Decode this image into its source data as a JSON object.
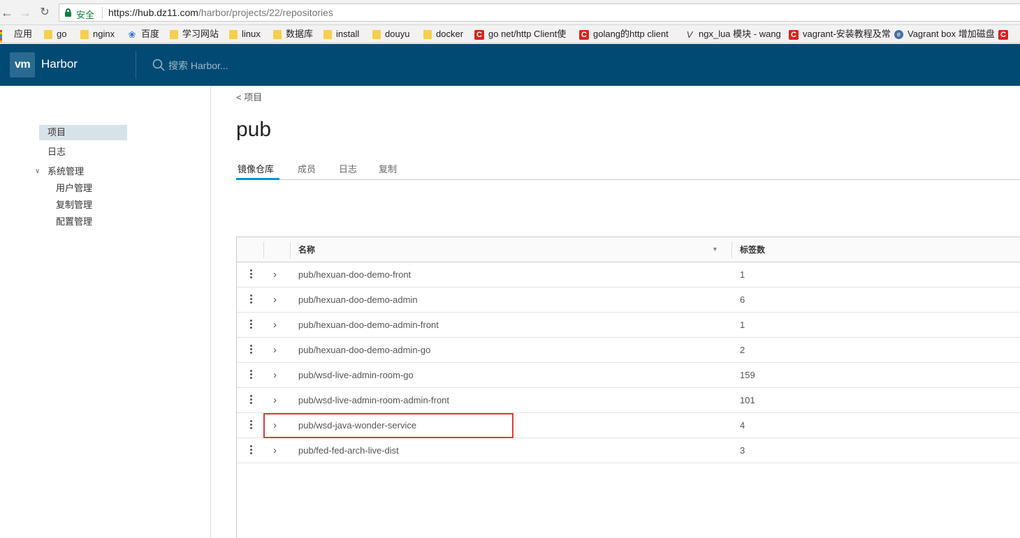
{
  "browser": {
    "secure_label": "安全",
    "url": "https://hub.dz11.com/harbor/projects/22/repositories",
    "url_host_part": "https://hub.dz11.com",
    "url_path_part": "/harbor/projects/22/repositories",
    "bookmarks": [
      {
        "label": "应用",
        "icon": "apps-icon"
      },
      {
        "label": "go",
        "icon": "folder-icon"
      },
      {
        "label": "nginx",
        "icon": "folder-icon"
      },
      {
        "label": "百度",
        "icon": "paw-icon"
      },
      {
        "label": "学习网站",
        "icon": "folder-icon"
      },
      {
        "label": "linux",
        "icon": "folder-icon"
      },
      {
        "label": "数据库",
        "icon": "folder-icon"
      },
      {
        "label": "install",
        "icon": "folder-icon"
      },
      {
        "label": "douyu",
        "icon": "folder-icon"
      },
      {
        "label": "docker",
        "icon": "folder-icon"
      },
      {
        "label": "go net/http Client使",
        "icon": "csdn-icon"
      },
      {
        "label": "golang的http client",
        "icon": "csdn-icon"
      },
      {
        "label": "ngx_lua 模块 - wang",
        "icon": "v-icon"
      },
      {
        "label": "vagrant-安装教程及常",
        "icon": "csdn-icon"
      },
      {
        "label": "Vagrant box 增加磁盘",
        "icon": "globe-icon"
      },
      {
        "label": "",
        "icon": "csdn-icon"
      }
    ]
  },
  "header": {
    "logo_text": "vm",
    "brand": "Harbor",
    "search_placeholder": "搜索 Harbor..."
  },
  "sidebar": {
    "items": [
      {
        "label": "项目",
        "active": true
      },
      {
        "label": "日志",
        "active": false
      },
      {
        "label": "系统管理",
        "active": false,
        "expanded": true
      }
    ],
    "subitems": [
      {
        "label": "用户管理"
      },
      {
        "label": "复制管理"
      },
      {
        "label": "配置管理"
      }
    ]
  },
  "main": {
    "breadcrumb": "< 项目",
    "title": "pub",
    "tabs": [
      {
        "label": "镜像仓库",
        "active": true
      },
      {
        "label": "成员",
        "active": false
      },
      {
        "label": "日志",
        "active": false
      },
      {
        "label": "复制",
        "active": false
      }
    ],
    "table": {
      "columns": [
        "名称",
        "标签数"
      ],
      "rows": [
        {
          "name": "pub/hexuan-doo-demo-front",
          "tags": "1"
        },
        {
          "name": "pub/hexuan-doo-demo-admin",
          "tags": "6"
        },
        {
          "name": "pub/hexuan-doo-demo-admin-front",
          "tags": "1"
        },
        {
          "name": "pub/hexuan-doo-demo-admin-go",
          "tags": "2"
        },
        {
          "name": "pub/wsd-live-admin-room-go",
          "tags": "159"
        },
        {
          "name": "pub/wsd-live-admin-room-admin-front",
          "tags": "101"
        },
        {
          "name": "pub/wsd-java-wonder-service",
          "tags": "4",
          "highlighted": true
        },
        {
          "name": "pub/fed-fed-arch-live-dist",
          "tags": "3"
        }
      ]
    }
  },
  "colors": {
    "header_bg": "#014a73",
    "tab_active": "#0094d2",
    "highlight": "#e0393e",
    "secure": "#0b8043"
  }
}
